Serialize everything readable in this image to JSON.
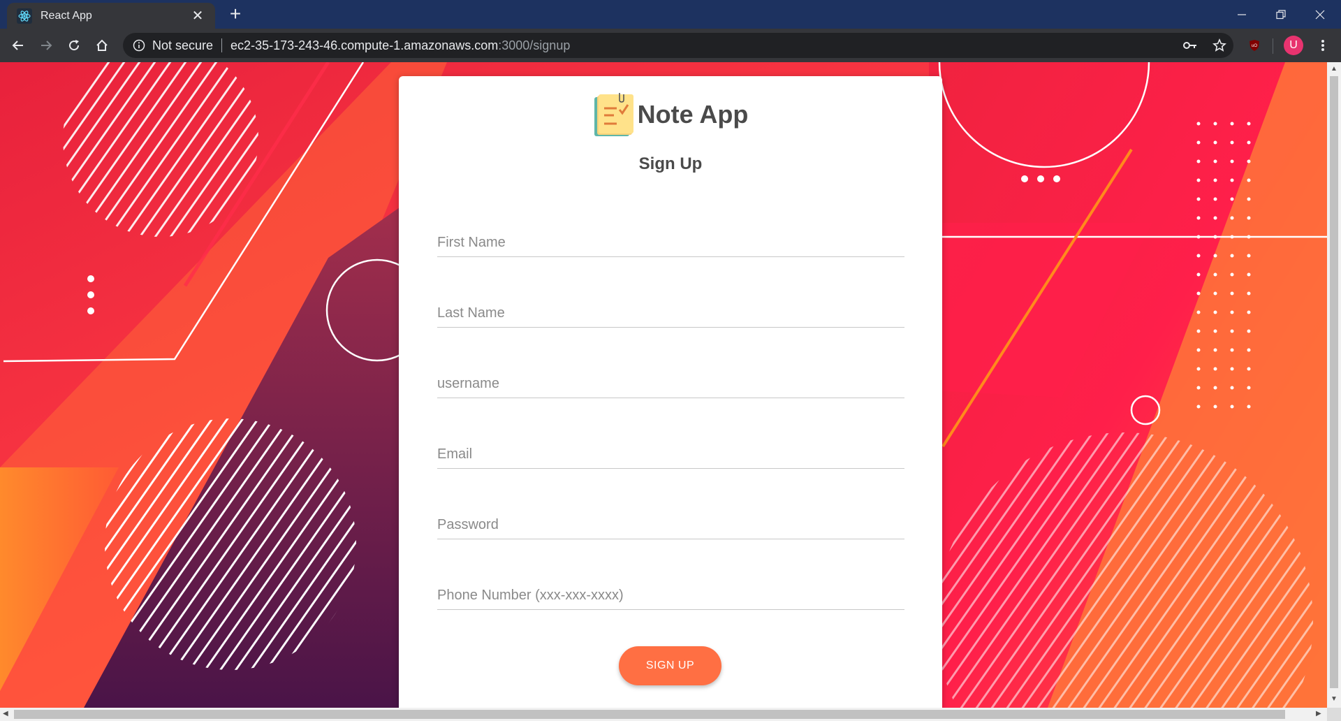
{
  "browser": {
    "tab_title": "React App",
    "new_tab_symbol": "+",
    "security_label": "Not secure",
    "url_host": "ec2-35-173-243-46.compute-1.amazonaws.com",
    "url_path": ":3000/signup",
    "profile_initial": "U"
  },
  "page": {
    "app_title": "Note App",
    "subtitle": "Sign Up",
    "fields": {
      "first_name": "First Name",
      "last_name": "Last Name",
      "username": "username",
      "email": "Email",
      "password": "Password",
      "phone": "Phone Number (xxx-xxx-xxxx)"
    },
    "signup_button": "SIGN UP"
  },
  "colors": {
    "accent": "#ff6f43",
    "chrome_titlebar": "#1d3260",
    "chrome_toolbar": "#35363a",
    "avatar": "#e8336f"
  }
}
